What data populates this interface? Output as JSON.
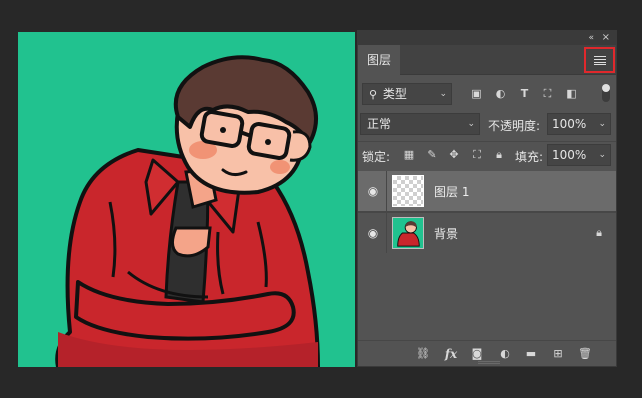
{
  "window": {
    "collapse_icon": "double-chevron-left-icon",
    "close_icon": "close-icon"
  },
  "canvas": {
    "background_color": "#21c28f",
    "content": "cartoon-illustration"
  },
  "layers_panel": {
    "tab_label": "图层",
    "menu_icon": "panel-menu-icon",
    "filter": {
      "kind_label": "类型",
      "icons": [
        "pixel-filter-icon",
        "adjustment-filter-icon",
        "type-filter-icon",
        "shape-filter-icon",
        "smart-object-filter-icon"
      ],
      "toggle": "filter-toggle"
    },
    "blend_mode": "正常",
    "opacity_label": "不透明度:",
    "opacity_value": "100%",
    "lock_label": "锁定:",
    "lock_icons": [
      "lock-transparent-pixels-icon",
      "lock-image-pixels-icon",
      "lock-position-icon",
      "lock-artboard-icon",
      "lock-all-icon"
    ],
    "fill_label": "填充:",
    "fill_value": "100%",
    "layers": [
      {
        "name": "图层 1",
        "selected": true,
        "visible": true,
        "locked": false,
        "thumbnail": "transparent"
      },
      {
        "name": "背景",
        "selected": false,
        "visible": true,
        "locked": true,
        "thumbnail": "background-art"
      }
    ],
    "bottom_icons": [
      "link-layers-icon",
      "fx-icon",
      "add-mask-icon",
      "adjustment-layer-icon",
      "new-group-icon",
      "new-layer-icon",
      "delete-icon"
    ],
    "fx_label": "fx",
    "highlight_color": "#e0282c"
  }
}
